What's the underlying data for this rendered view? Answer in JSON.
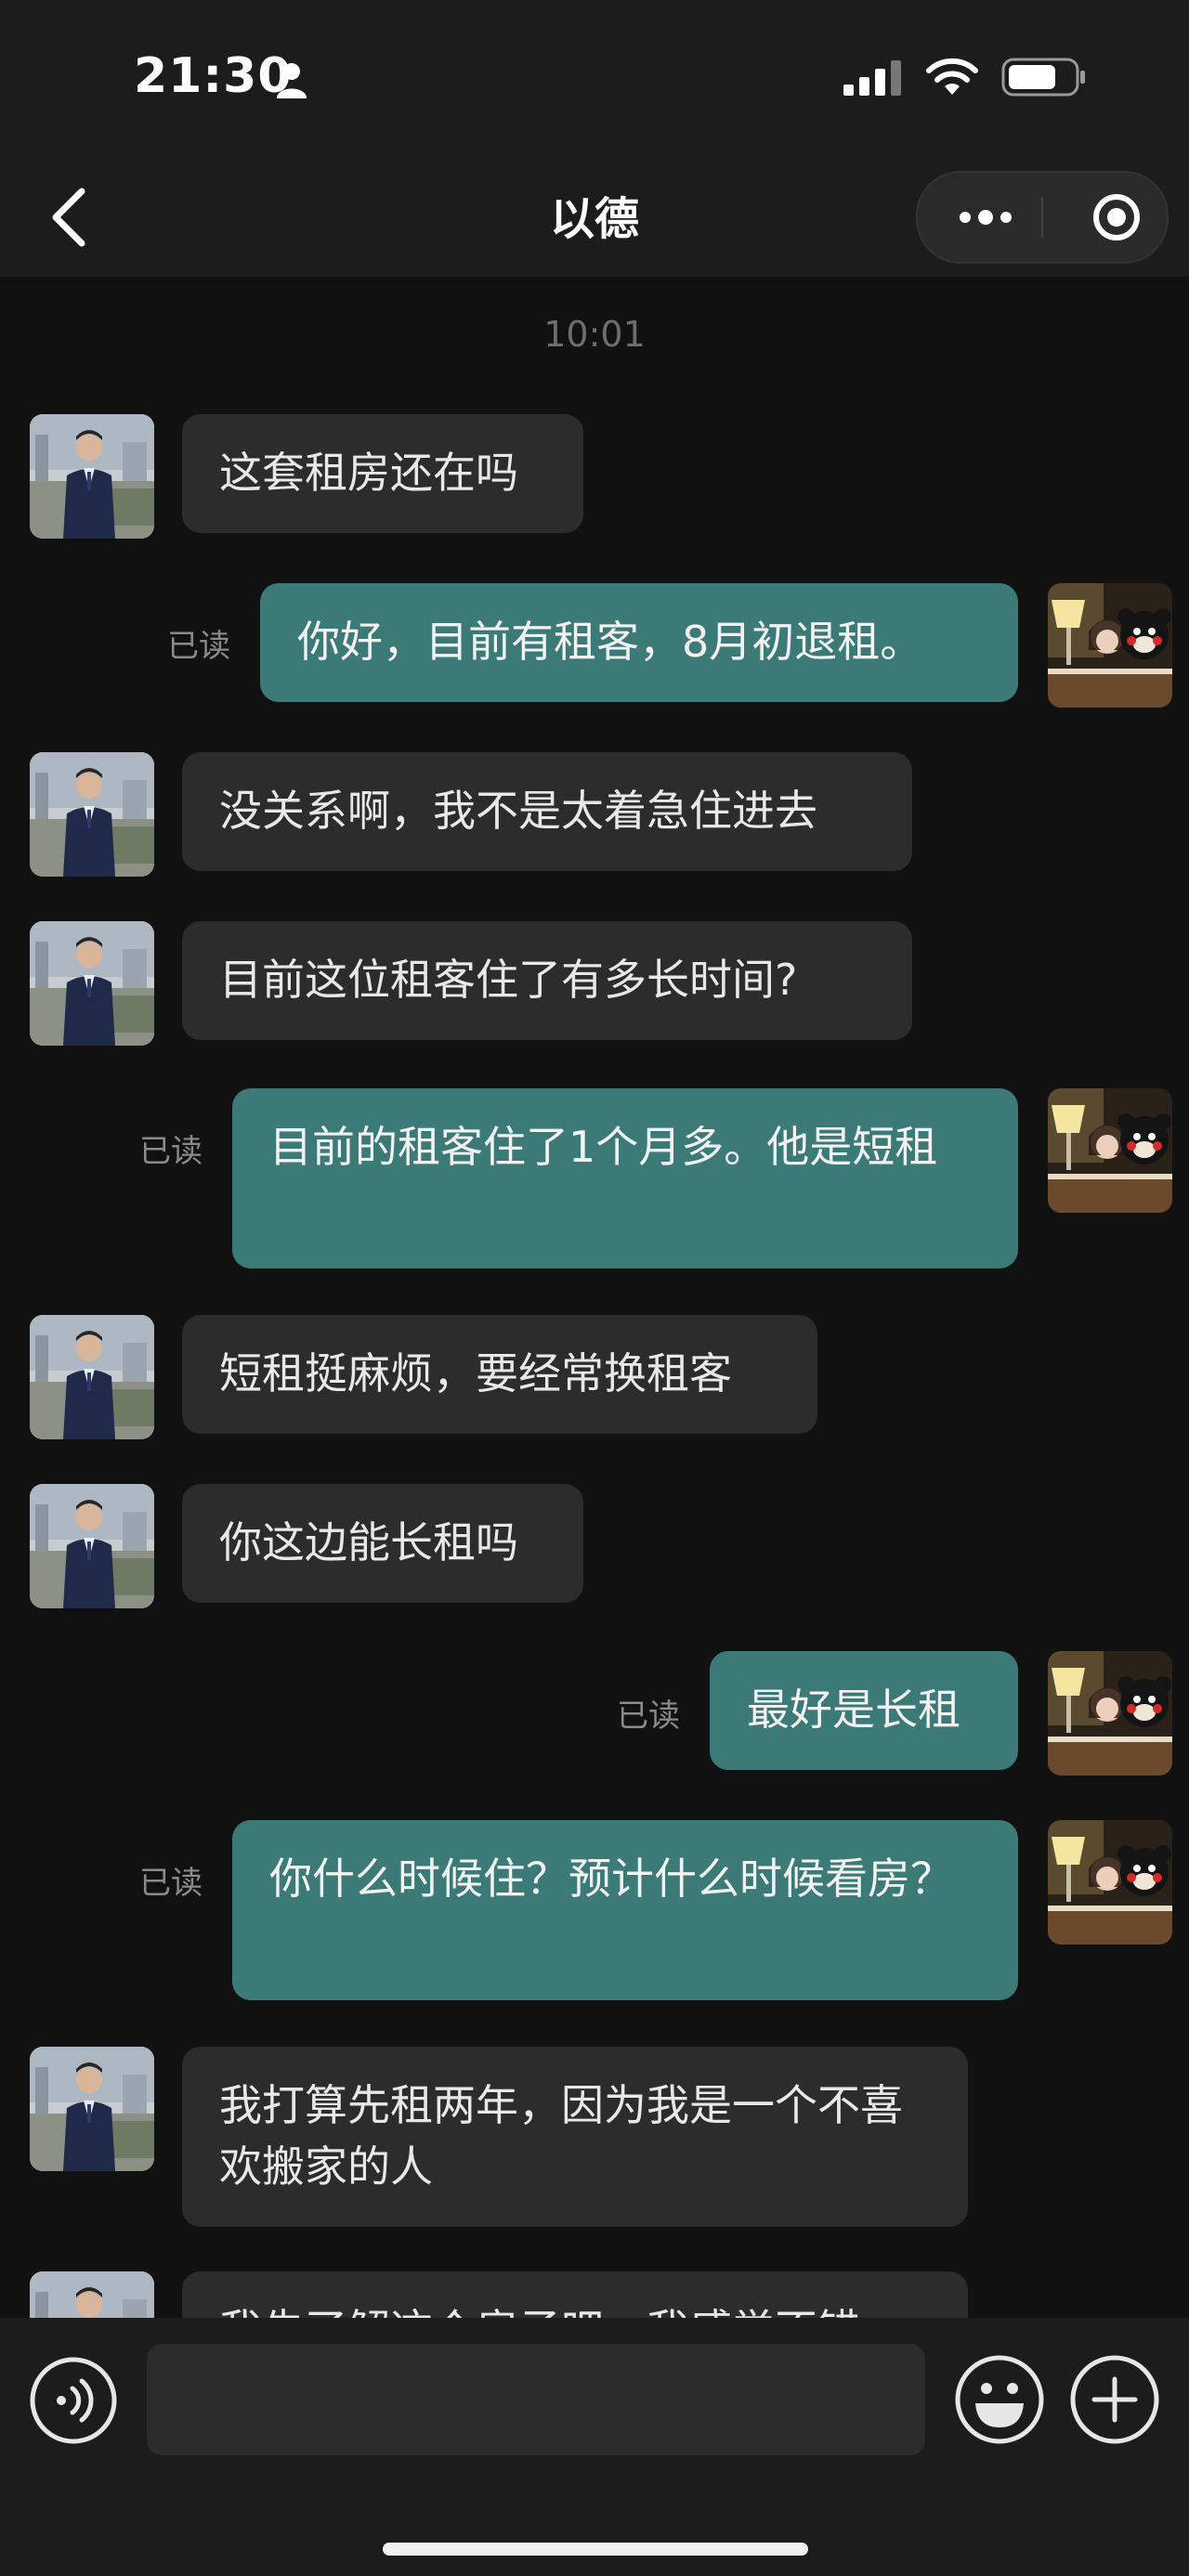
{
  "status_bar": {
    "time": "21:30",
    "icons": [
      "person-icon",
      "cellular-signal-icon",
      "wifi-icon",
      "battery-icon"
    ]
  },
  "nav": {
    "back_icon": "chevron-left-icon",
    "title": "以德",
    "capsule_icons": [
      "more-icon",
      "target-icon"
    ]
  },
  "chat": {
    "timestamp": "10:01",
    "read_label": "已读",
    "messages": [
      {
        "side": "in",
        "text": "这套租房还在吗"
      },
      {
        "side": "out",
        "text": "你好，目前有租客，8月初退租。",
        "status": "已读"
      },
      {
        "side": "in",
        "text": "没关系啊，我不是太着急住进去"
      },
      {
        "side": "in",
        "text": "目前这位租客住了有多长时间?"
      },
      {
        "side": "out",
        "text": "目前的租客住了1个月多。他是短租",
        "status": "已读"
      },
      {
        "side": "in",
        "text": "短租挺麻烦，要经常换租客"
      },
      {
        "side": "in",
        "text": "你这边能长租吗"
      },
      {
        "side": "out",
        "text": "最好是长租",
        "status": "已读"
      },
      {
        "side": "out",
        "text": "你什么时候住？预计什么时候看房？",
        "status": "已读"
      },
      {
        "side": "in",
        "text": "我打算先租两年，因为我是一个不喜欢搬家的人"
      },
      {
        "side": "in",
        "text": "我先了解这个房子吧，我感觉不错"
      }
    ]
  },
  "input_bar": {
    "icons": [
      "voice-icon",
      "emoji-icon",
      "add-icon"
    ],
    "text_value": ""
  },
  "colors": {
    "background": "#111111",
    "bar": "#1c1c1c",
    "incoming_bubble": "#2c2c2c",
    "outgoing_bubble": "#3c7a78"
  }
}
